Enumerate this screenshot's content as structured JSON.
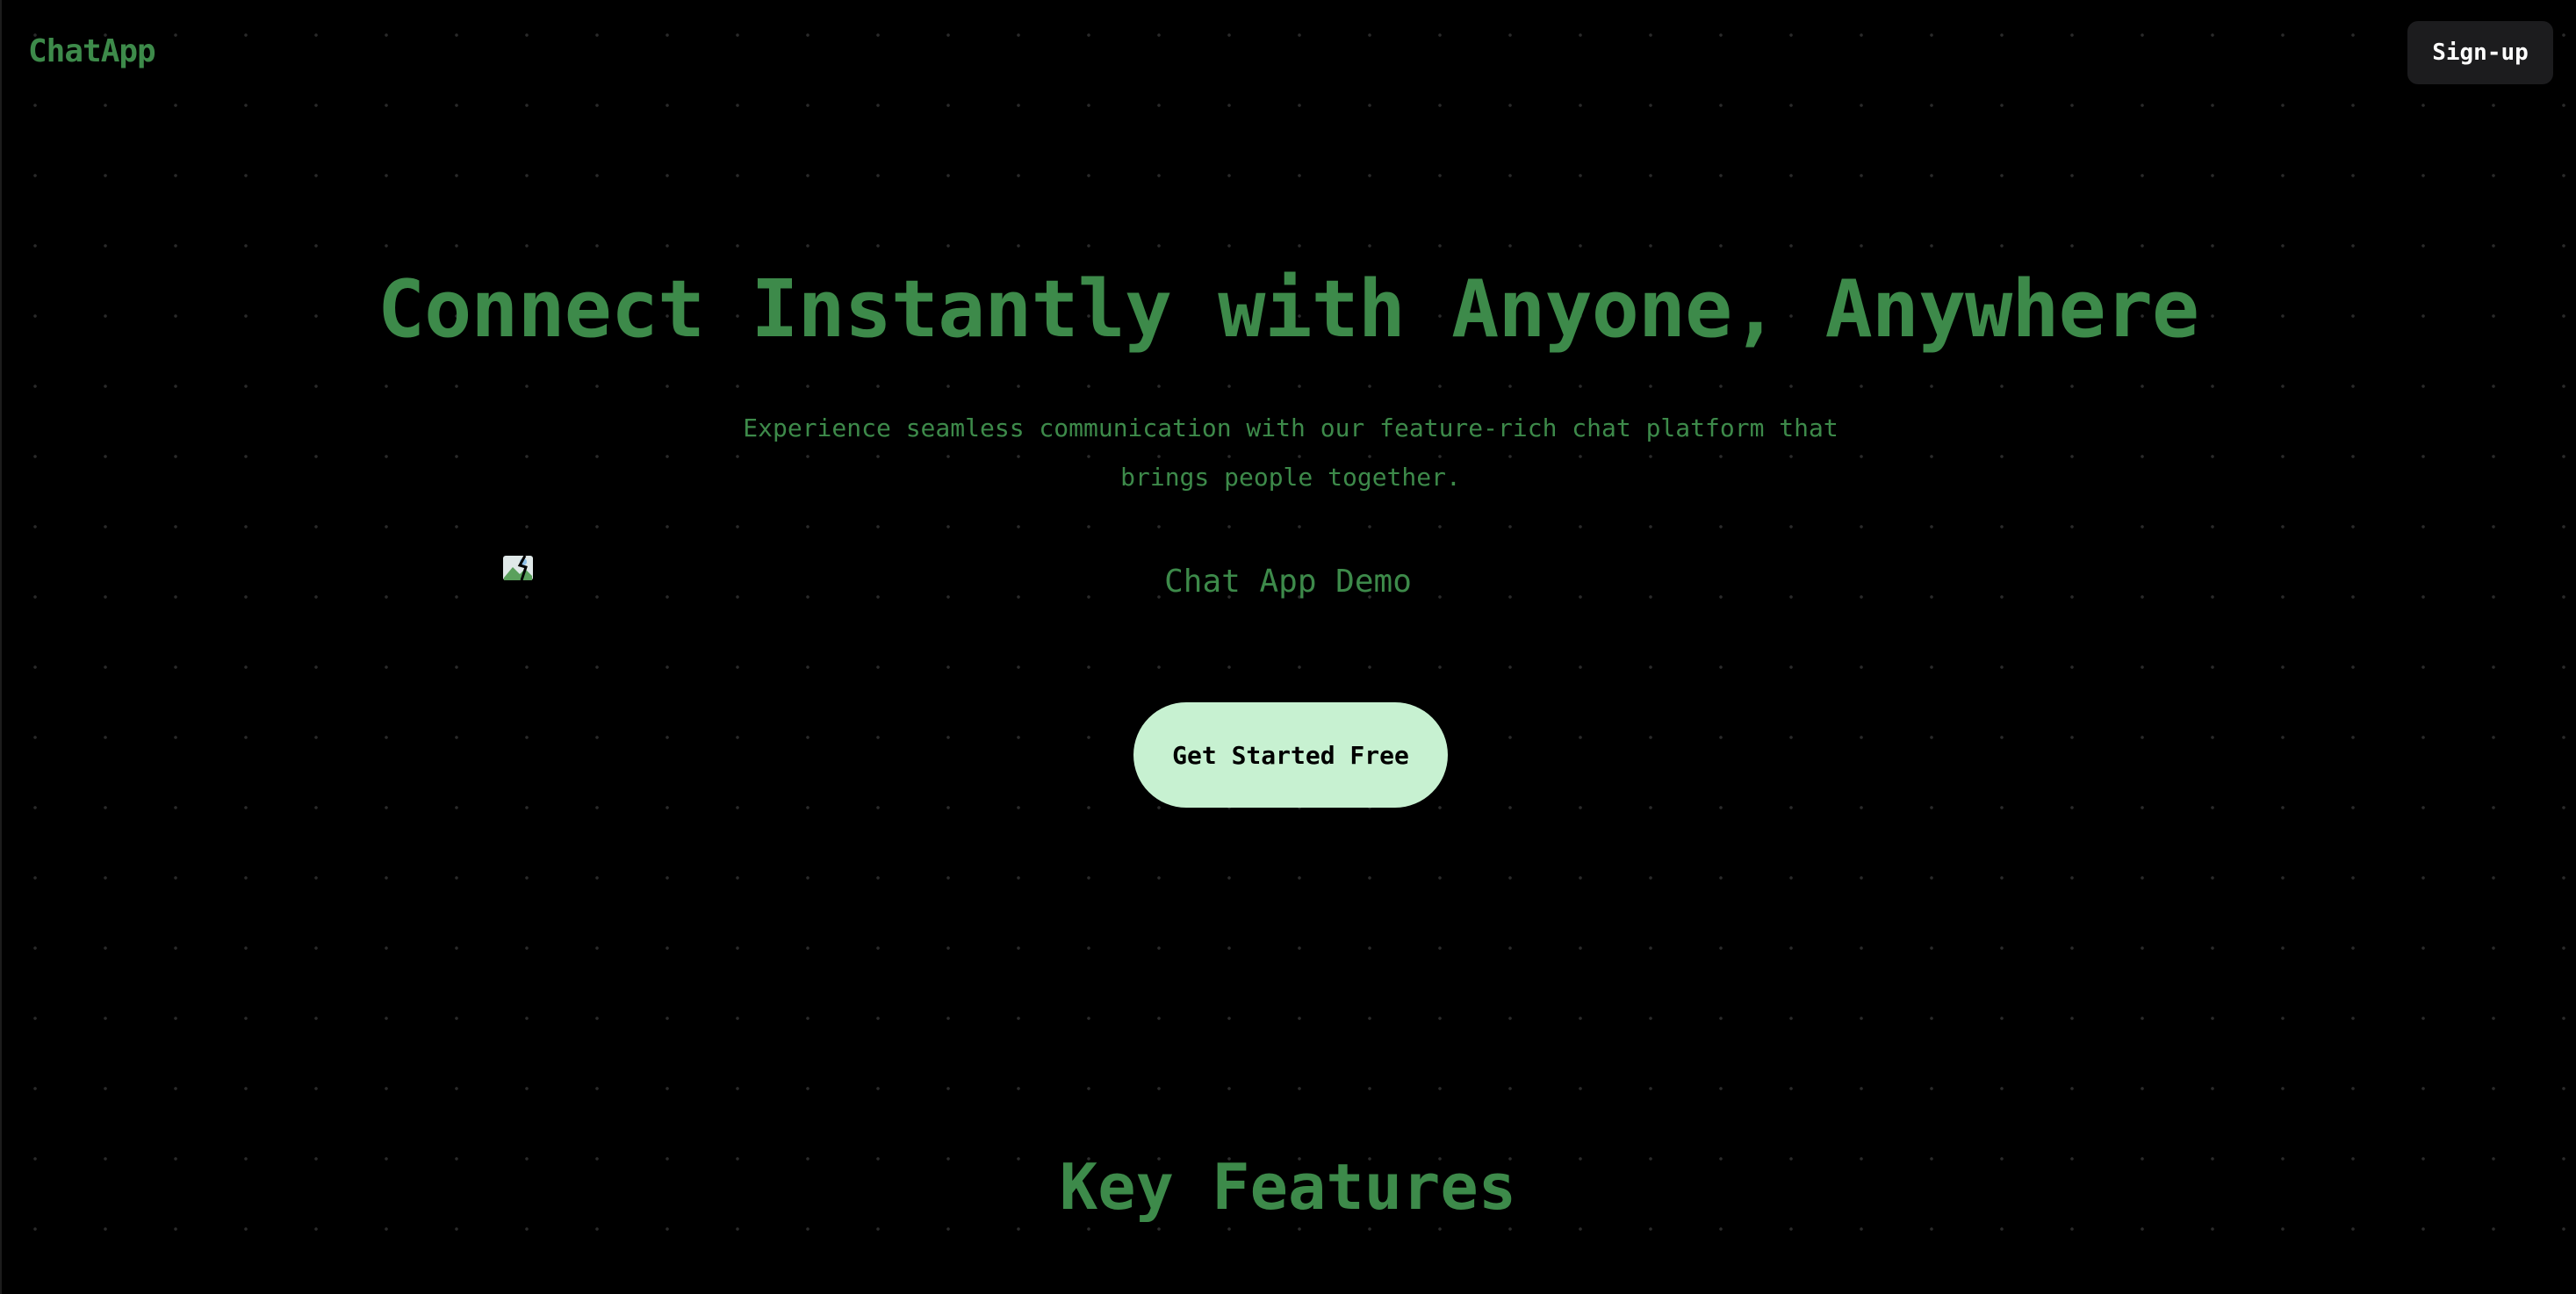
{
  "brand": {
    "name": "ChatApp"
  },
  "header": {
    "signup_label": "Sign-up"
  },
  "hero": {
    "title": "Connect Instantly with Anyone, Anywhere",
    "subtitle": "Experience seamless communication with our feature-rich chat platform that brings people together.",
    "demo_image_alt": "Chat App Demo",
    "demo_image_icon": "broken-image-icon",
    "cta_label": "Get Started Free"
  },
  "features": {
    "title": "Key Features"
  },
  "colors": {
    "background": "#000000",
    "accent_green": "#3d8a4a",
    "cta_background": "#c7f1d1",
    "signup_background": "#1c1c1e"
  }
}
